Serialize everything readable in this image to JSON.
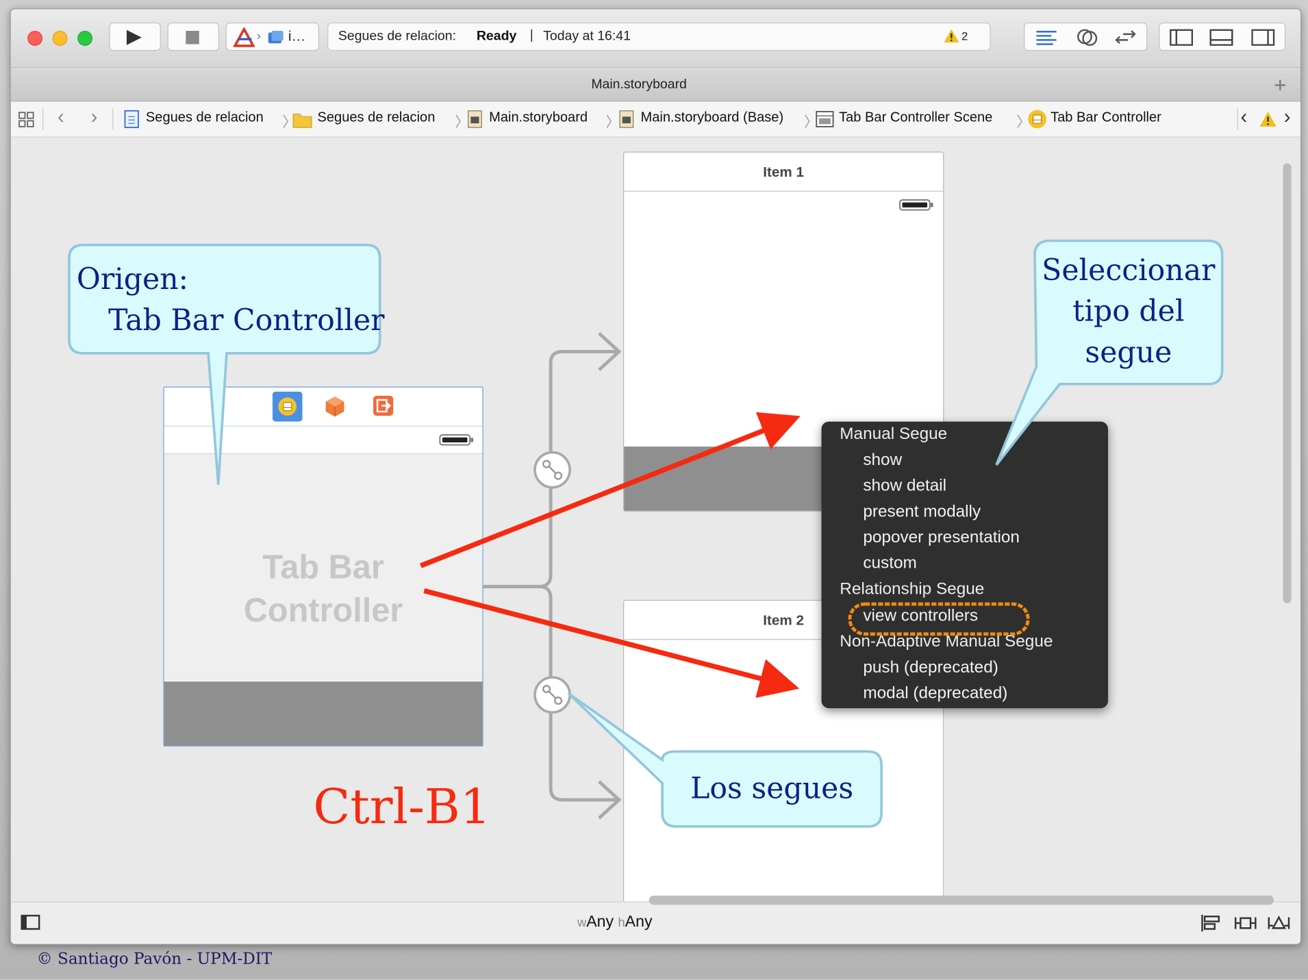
{
  "toolbar": {
    "scheme_target": "i…",
    "status_project": "Segues de relacion:",
    "status_state": "Ready",
    "status_divider": "|",
    "status_time": "Today at 16:41",
    "warning_count": "2"
  },
  "tabbar": {
    "title": "Main.storyboard",
    "add_label": "+"
  },
  "jumpbar": {
    "crumbs": [
      "Segues de relacion",
      "Segues de relacion",
      "Main.storyboard",
      "Main.storyboard (Base)",
      "Tab Bar Controller Scene",
      "Tab Bar Controller"
    ]
  },
  "canvas": {
    "source_scene_title": "Tab Bar Controller",
    "item1_title": "Item 1",
    "item2_title": "Item 2"
  },
  "segue_menu": {
    "manual_header": "Manual Segue",
    "manual_items": [
      "show",
      "show detail",
      "present modally",
      "popover presentation",
      "custom"
    ],
    "relationship_header": "Relationship Segue",
    "relationship_items": [
      "view controllers"
    ],
    "nonadaptive_header": "Non-Adaptive Manual Segue",
    "nonadaptive_items": [
      "push (deprecated)",
      "modal (deprecated)"
    ]
  },
  "annotations": {
    "origen_line1": "Origen:",
    "origen_line2": "Tab Bar Controller",
    "select_line1": "Seleccionar",
    "select_line2": "tipo del",
    "select_line3": "segue",
    "segues_label": "Los segues",
    "shortcut": "Ctrl-B1"
  },
  "bottombar": {
    "w_prefix": "w",
    "w_value": "Any",
    "h_prefix": "h",
    "h_value": "Any"
  },
  "footer": {
    "copyright": "© Santiago Pavón - UPM-DIT"
  },
  "colors": {
    "callout_fill": "#d9fbfd",
    "callout_border": "#94c6dc",
    "arrow_red": "#f52a10",
    "highlight_orange": "#f08a13",
    "callout_text": "#0d1f87"
  }
}
